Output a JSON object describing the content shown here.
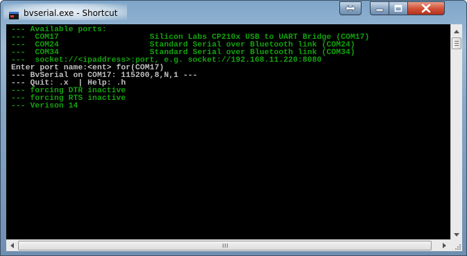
{
  "window": {
    "title": "bvserial.exe - Shortcut",
    "icon": "console-app-icon",
    "controls": [
      "swap-icon",
      "minimize-icon",
      "maximize-icon",
      "close-icon"
    ]
  },
  "console": {
    "colors": {
      "green": "#13a10e",
      "white": "#c0c0c0",
      "background": "#000000"
    },
    "lines": [
      {
        "text": "--- Available ports:",
        "color": "green"
      },
      {
        "text": "---  COM17                   Silicon Labs CP210x USB to UART Bridge (COM17)",
        "color": "green"
      },
      {
        "text": "---  COM24                   Standard Serial over Bluetooth link (COM24)",
        "color": "green"
      },
      {
        "text": "---  COM34                   Standard Serial over Bluetooth link (COM34)",
        "color": "green"
      },
      {
        "text": "---  socket://<ipaddress>:port, e.g. socket://192.168.11.220:8080",
        "color": "green"
      },
      {
        "text": "Enter port name:<ent> for(COM17)",
        "color": "white"
      },
      {
        "text": "--- BvSerial on COM17: 115200,8,N,1 ---",
        "color": "white"
      },
      {
        "text": "--- Quit: .x  | Help: .h",
        "color": "white"
      },
      {
        "text": "--- forcing DTR inactive",
        "color": "green"
      },
      {
        "text": "--- forcing RTS inactive",
        "color": "green"
      },
      {
        "text": "--- Verison 14",
        "color": "green"
      }
    ]
  },
  "scrollbars": {
    "vertical": {
      "up_icon": "arrow-up-icon",
      "down_icon": "arrow-down-icon",
      "position": 0.0
    },
    "horizontal": {
      "left_icon": "arrow-left-icon",
      "right_icon": "arrow-right-icon",
      "grip_label": "III"
    }
  }
}
